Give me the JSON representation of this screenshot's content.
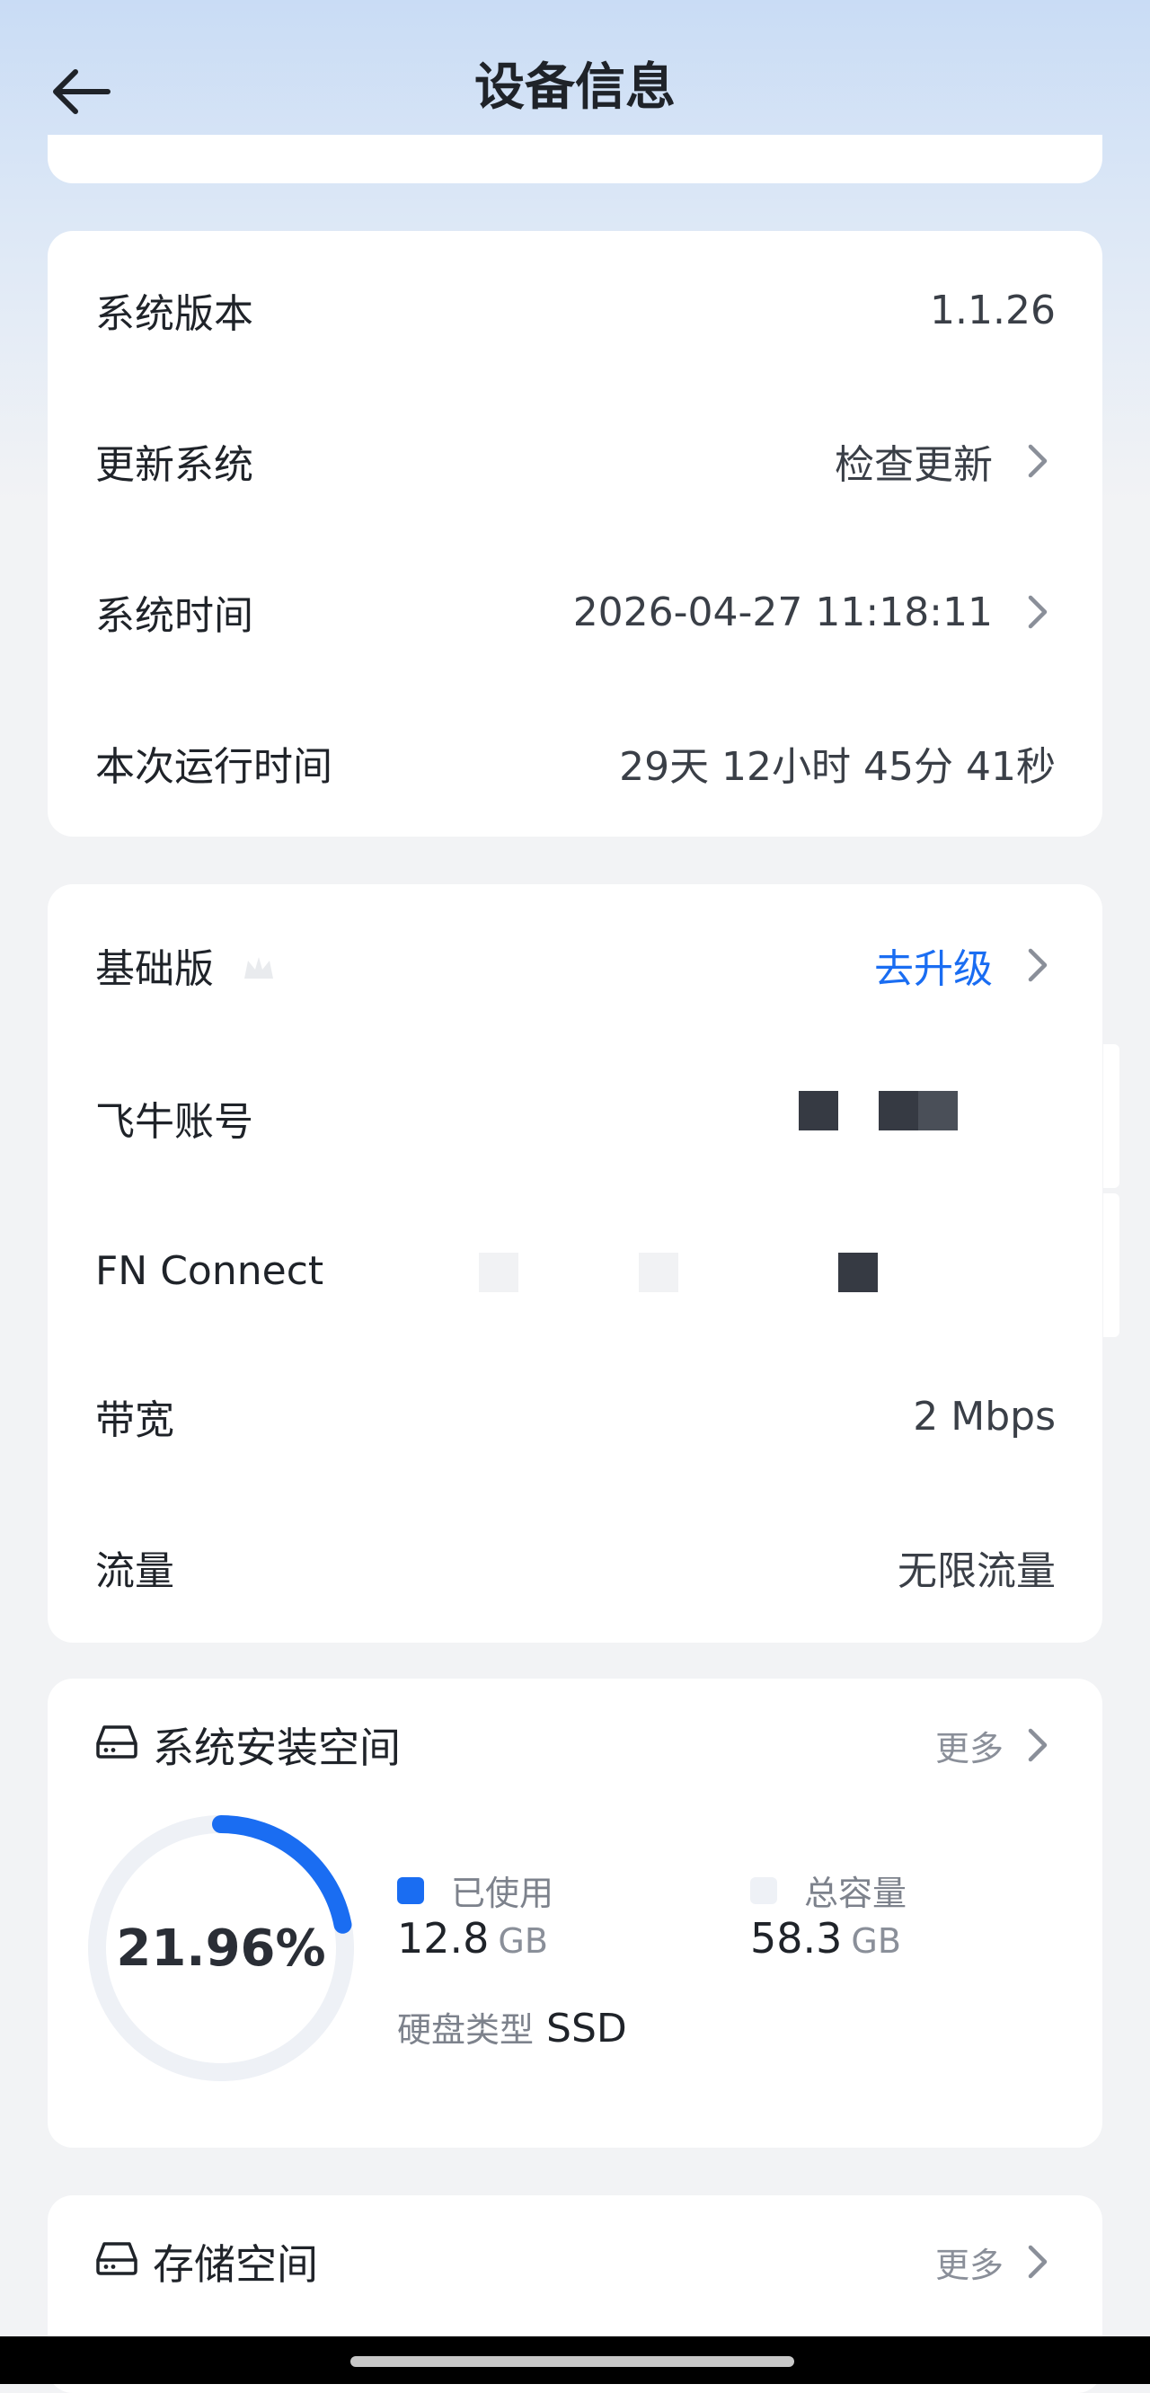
{
  "header": {
    "title": "设备信息"
  },
  "system_card": {
    "rows": [
      {
        "label": "系统版本",
        "value": "1.1.26"
      },
      {
        "label": "更新系统",
        "value": "检查更新"
      },
      {
        "label": "系统时间",
        "value": "2026-04-27 11:18:11"
      },
      {
        "label": "本次运行时间",
        "value": "29天 12小时 45分 41秒"
      }
    ]
  },
  "plan_card": {
    "rows": [
      {
        "label": "基础版",
        "value": "去升级"
      },
      {
        "label": "飞牛账号",
        "value": ""
      },
      {
        "label": "FN Connect",
        "value": ""
      },
      {
        "label": "带宽",
        "value": "2 Mbps"
      },
      {
        "label": "流量",
        "value": "无限流量"
      }
    ]
  },
  "install_space": {
    "title": "系统安装空间",
    "more_label": "更多",
    "percent_label": "21.96%",
    "used_fraction": 0.2196,
    "used_label": "已使用",
    "used_value": "12.8",
    "used_unit": "GB",
    "total_label": "总容量",
    "total_value": "58.3",
    "total_unit": "GB",
    "disk_type_label": "硬盘类型",
    "disk_type_value": "SSD",
    "colors": {
      "used": "#1a6df2",
      "free": "#eef1f6"
    }
  },
  "storage_space": {
    "title": "存储空间",
    "more_label": "更多"
  }
}
